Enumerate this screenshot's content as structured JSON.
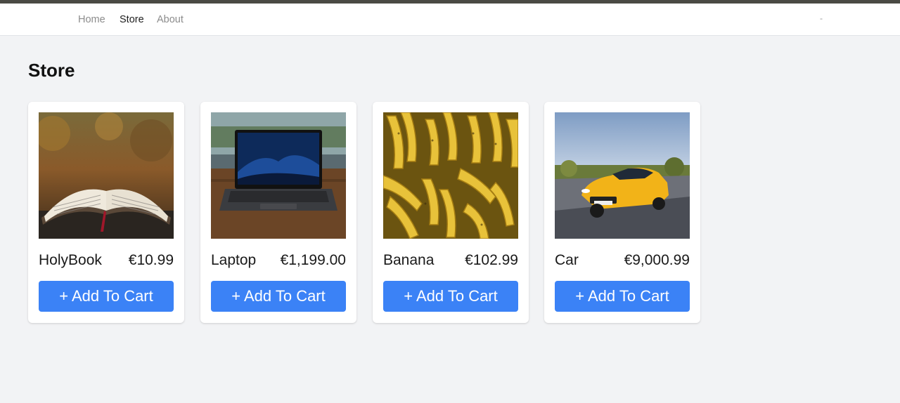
{
  "nav": {
    "items": [
      {
        "label": "Home",
        "active": false
      },
      {
        "label": "Store",
        "active": true
      },
      {
        "label": "About",
        "active": false
      }
    ],
    "right_text": "-"
  },
  "page": {
    "title": "Store"
  },
  "products": [
    {
      "name": "HolyBook",
      "price": "€10.99",
      "image": "open-book-photo",
      "button_label": "+ Add To Cart"
    },
    {
      "name": "Laptop",
      "price": "€1,199.00",
      "image": "laptop-photo",
      "button_label": "+ Add To Cart"
    },
    {
      "name": "Banana",
      "price": "€102.99",
      "image": "bananas-photo",
      "button_label": "+ Add To Cart"
    },
    {
      "name": "Car",
      "price": "€9,000.99",
      "image": "yellow-car-photo",
      "button_label": "+ Add To Cart"
    }
  ],
  "colors": {
    "accent": "#3b82f6",
    "background": "#f2f3f5",
    "nav_active": "#1f1f1f",
    "nav_inactive": "#8c8c8c"
  }
}
